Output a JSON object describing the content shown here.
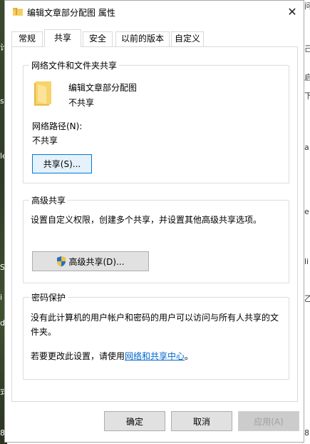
{
  "window": {
    "title": "编辑文章部分配图 属性",
    "close_glyph": "✕"
  },
  "tabs": [
    {
      "label": "常规"
    },
    {
      "label": "共享"
    },
    {
      "label": "安全"
    },
    {
      "label": "以前的版本"
    },
    {
      "label": "自定义"
    }
  ],
  "network_share": {
    "group_title": "网络文件和文件夹共享",
    "folder_name": "编辑文章部分配图",
    "share_status": "不共享",
    "path_label": "网络路径(N):",
    "path_value": "不共享",
    "share_button": "共享(S)..."
  },
  "advanced_share": {
    "group_title": "高级共享",
    "description": "设置自定义权限，创建多个共享，并设置其他高级共享选项。",
    "button": "高级共享(D)..."
  },
  "password": {
    "group_title": "密码保护",
    "description": "没有此计算机的用户帐户和密码的用户可以访问与所有人共享的文件夹。",
    "change_prefix": "若要更改此设置，请使用",
    "link": "网络和共享中心",
    "change_suffix": "。"
  },
  "footer": {
    "ok": "确定",
    "cancel": "取消",
    "apply": "应用(A)"
  },
  "edge_left_glyphs": [
    "计",
    "si",
    "le",
    "S",
    "i",
    "di",
    "式",
    "8"
  ],
  "edge_right_glyphs": [
    "问",
    "己",
    "启",
    "下",
    "a",
    "e",
    "li",
    "乙",
    "8"
  ]
}
